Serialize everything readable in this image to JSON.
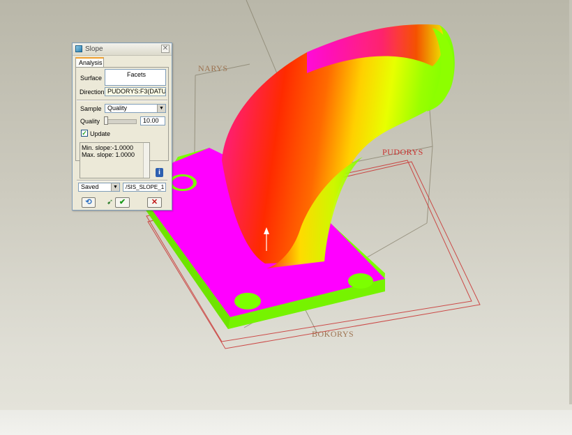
{
  "viewport": {
    "datum_planes": {
      "narys": "NARYS",
      "pudorys": "PUDORYS",
      "bokorys": "BOKORYS"
    },
    "colors": {
      "background_top": "#b9b7a9",
      "background_bottom": "#e6e5dc",
      "slope_min": "#ff00ff",
      "slope_mid": "#ff2a00",
      "slope_max": "#7fff00",
      "datum_red": "#c9302f",
      "datum_brown": "#9d7350"
    }
  },
  "dialog": {
    "title": "Slope",
    "close_symbol": "✕",
    "tab": "Analysis",
    "surface": {
      "label": "Surface",
      "value": "Facets"
    },
    "direction": {
      "label": "Direction",
      "value": "PUDORYS:F3(DATU"
    },
    "sample": {
      "label": "Sample",
      "value": "Quality"
    },
    "quality": {
      "label": "Quality",
      "value": "10.00"
    },
    "update": {
      "label": "Update",
      "checked": true
    },
    "results": {
      "min_slope": "Min. slope:-1.0000",
      "max_slope": "Max. slope: 1.0000"
    },
    "saved": {
      "value": "Saved",
      "name": "/SIS_SLOPE_1"
    },
    "buttons": {
      "repaint_icon": "repaint-icon",
      "select_icon": "cursor-select-icon",
      "ok_icon": "checkmark-icon",
      "cancel_icon": "x-icon"
    }
  }
}
